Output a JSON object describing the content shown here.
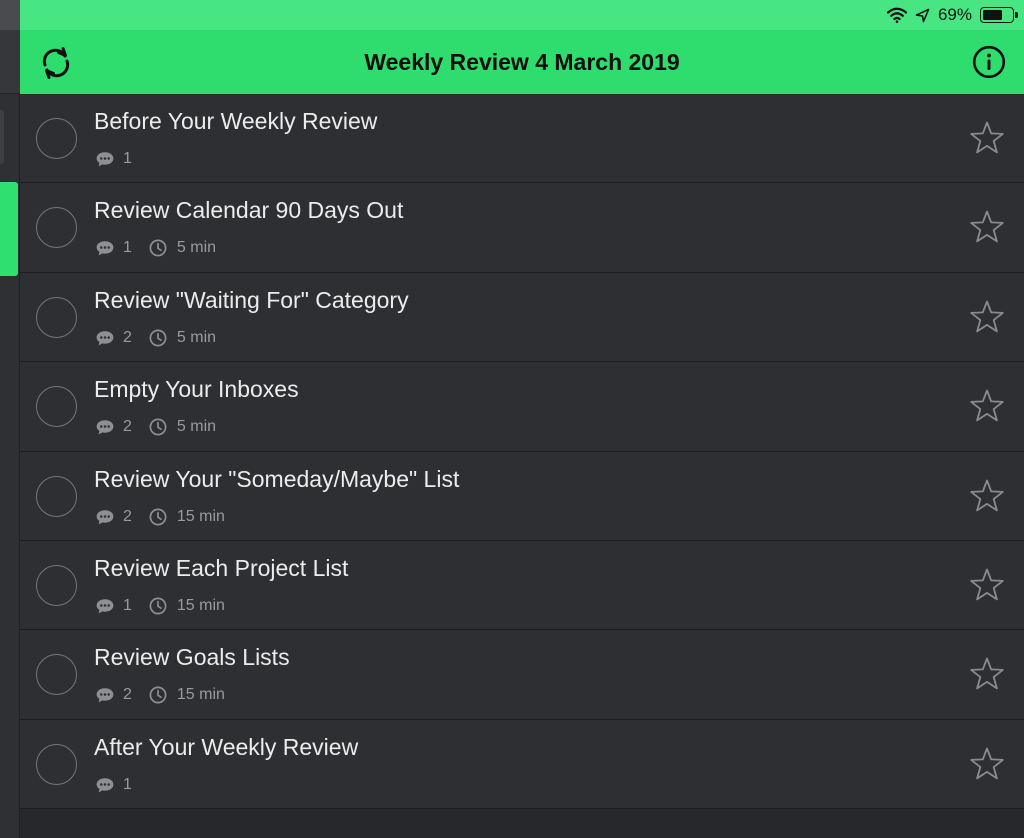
{
  "status_bar": {
    "battery_text": "69%",
    "battery_level": 0.69
  },
  "header": {
    "title": "Weekly Review 4 March 2019"
  },
  "colors": {
    "accent": "#2edd6e",
    "status_bar": "#47e683",
    "row_bg": "#2e2f33",
    "text": "#ececec",
    "meta_text": "#9a9a9e"
  },
  "tasks": [
    {
      "title": "Before Your Weekly Review",
      "comments": "1",
      "duration": ""
    },
    {
      "title": "Review Calendar 90 Days Out",
      "comments": "1",
      "duration": "5 min"
    },
    {
      "title": "Review \"Waiting For\" Category",
      "comments": "2",
      "duration": "5 min"
    },
    {
      "title": "Empty Your Inboxes",
      "comments": "2",
      "duration": "5 min"
    },
    {
      "title": "Review Your \"Someday/Maybe\" List",
      "comments": "2",
      "duration": "15 min"
    },
    {
      "title": "Review Each Project List",
      "comments": "1",
      "duration": "15 min"
    },
    {
      "title": "Review Goals Lists",
      "comments": "2",
      "duration": "15 min"
    },
    {
      "title": "After Your Weekly Review",
      "comments": "1",
      "duration": ""
    }
  ],
  "icons": {
    "sync": "sync-icon",
    "info": "info-icon",
    "wifi": "wifi-icon",
    "location": "location-arrow-icon",
    "battery": "battery-icon",
    "comment": "comment-icon",
    "clock": "clock-icon",
    "star": "star-outline-icon",
    "checkbox": "checkbox-circle-icon"
  }
}
